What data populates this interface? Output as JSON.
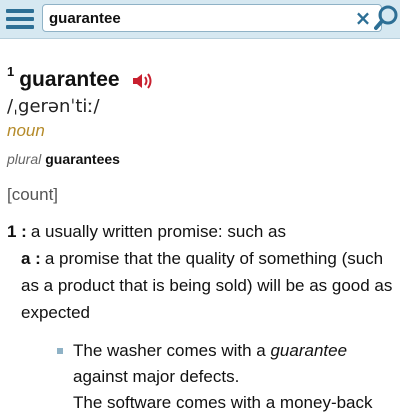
{
  "search": {
    "query": "guarantee"
  },
  "entry": {
    "homograph": "1",
    "headword": "guarantee",
    "pronunciation": "/ˌgerənˈtiː/",
    "part_of_speech": "noun",
    "plural_label": "plural",
    "plural_form": "guarantees",
    "grammar_label": "[count]",
    "sense_num": "1 :",
    "sense_text": "a usually written promise: such as",
    "subsense_letter": "a :",
    "subsense_text": "a promise that the quality of something (such as a product that is being sold) will be as good as expected",
    "examples": [
      {
        "before": "The washer comes with a ",
        "em": "guarantee",
        "after": " against major defects."
      },
      {
        "text": "The software comes with a money-back"
      }
    ]
  },
  "icons": {
    "menu": "hamburger-icon",
    "clear": "clear-icon",
    "search": "magnifier-icon",
    "audio": "speaker-icon"
  },
  "colors": {
    "topbar": "#d6e8f1",
    "accent": "#2d6f95",
    "pos": "#b58b2a",
    "audio": "#c8202f"
  }
}
